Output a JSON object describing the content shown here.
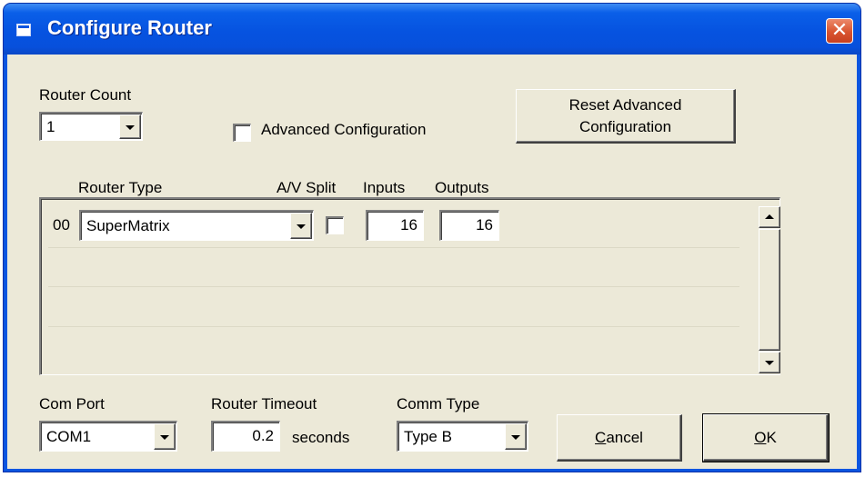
{
  "window": {
    "title": "Configure Router",
    "close_label": "✕",
    "app_icon": "window-icon"
  },
  "router_count": {
    "label": "Router Count",
    "value": "1"
  },
  "advanced": {
    "label": "Advanced Configuration",
    "checked": false
  },
  "reset_button": {
    "line1": "Reset Advanced",
    "line2": "Configuration"
  },
  "grid": {
    "headers": {
      "router_type": "Router Type",
      "av_split": "A/V Split",
      "inputs": "Inputs",
      "outputs": "Outputs"
    },
    "rows": [
      {
        "index": "00",
        "router_type": "SuperMatrix",
        "av_split": false,
        "inputs": "16",
        "outputs": "16"
      }
    ]
  },
  "com_port": {
    "label": "Com Port",
    "value": "COM1"
  },
  "router_timeout": {
    "label": "Router Timeout",
    "value": "0.2",
    "unit": "seconds"
  },
  "comm_type": {
    "label": "Comm Type",
    "value": "Type B"
  },
  "buttons": {
    "cancel_accel": "C",
    "cancel_rest": "ancel",
    "ok_accel": "O",
    "ok_rest": "K"
  },
  "colors": {
    "titlebar": "#0b55e0",
    "dialog_face": "#ece9d8",
    "close_button": "#d9542f"
  }
}
